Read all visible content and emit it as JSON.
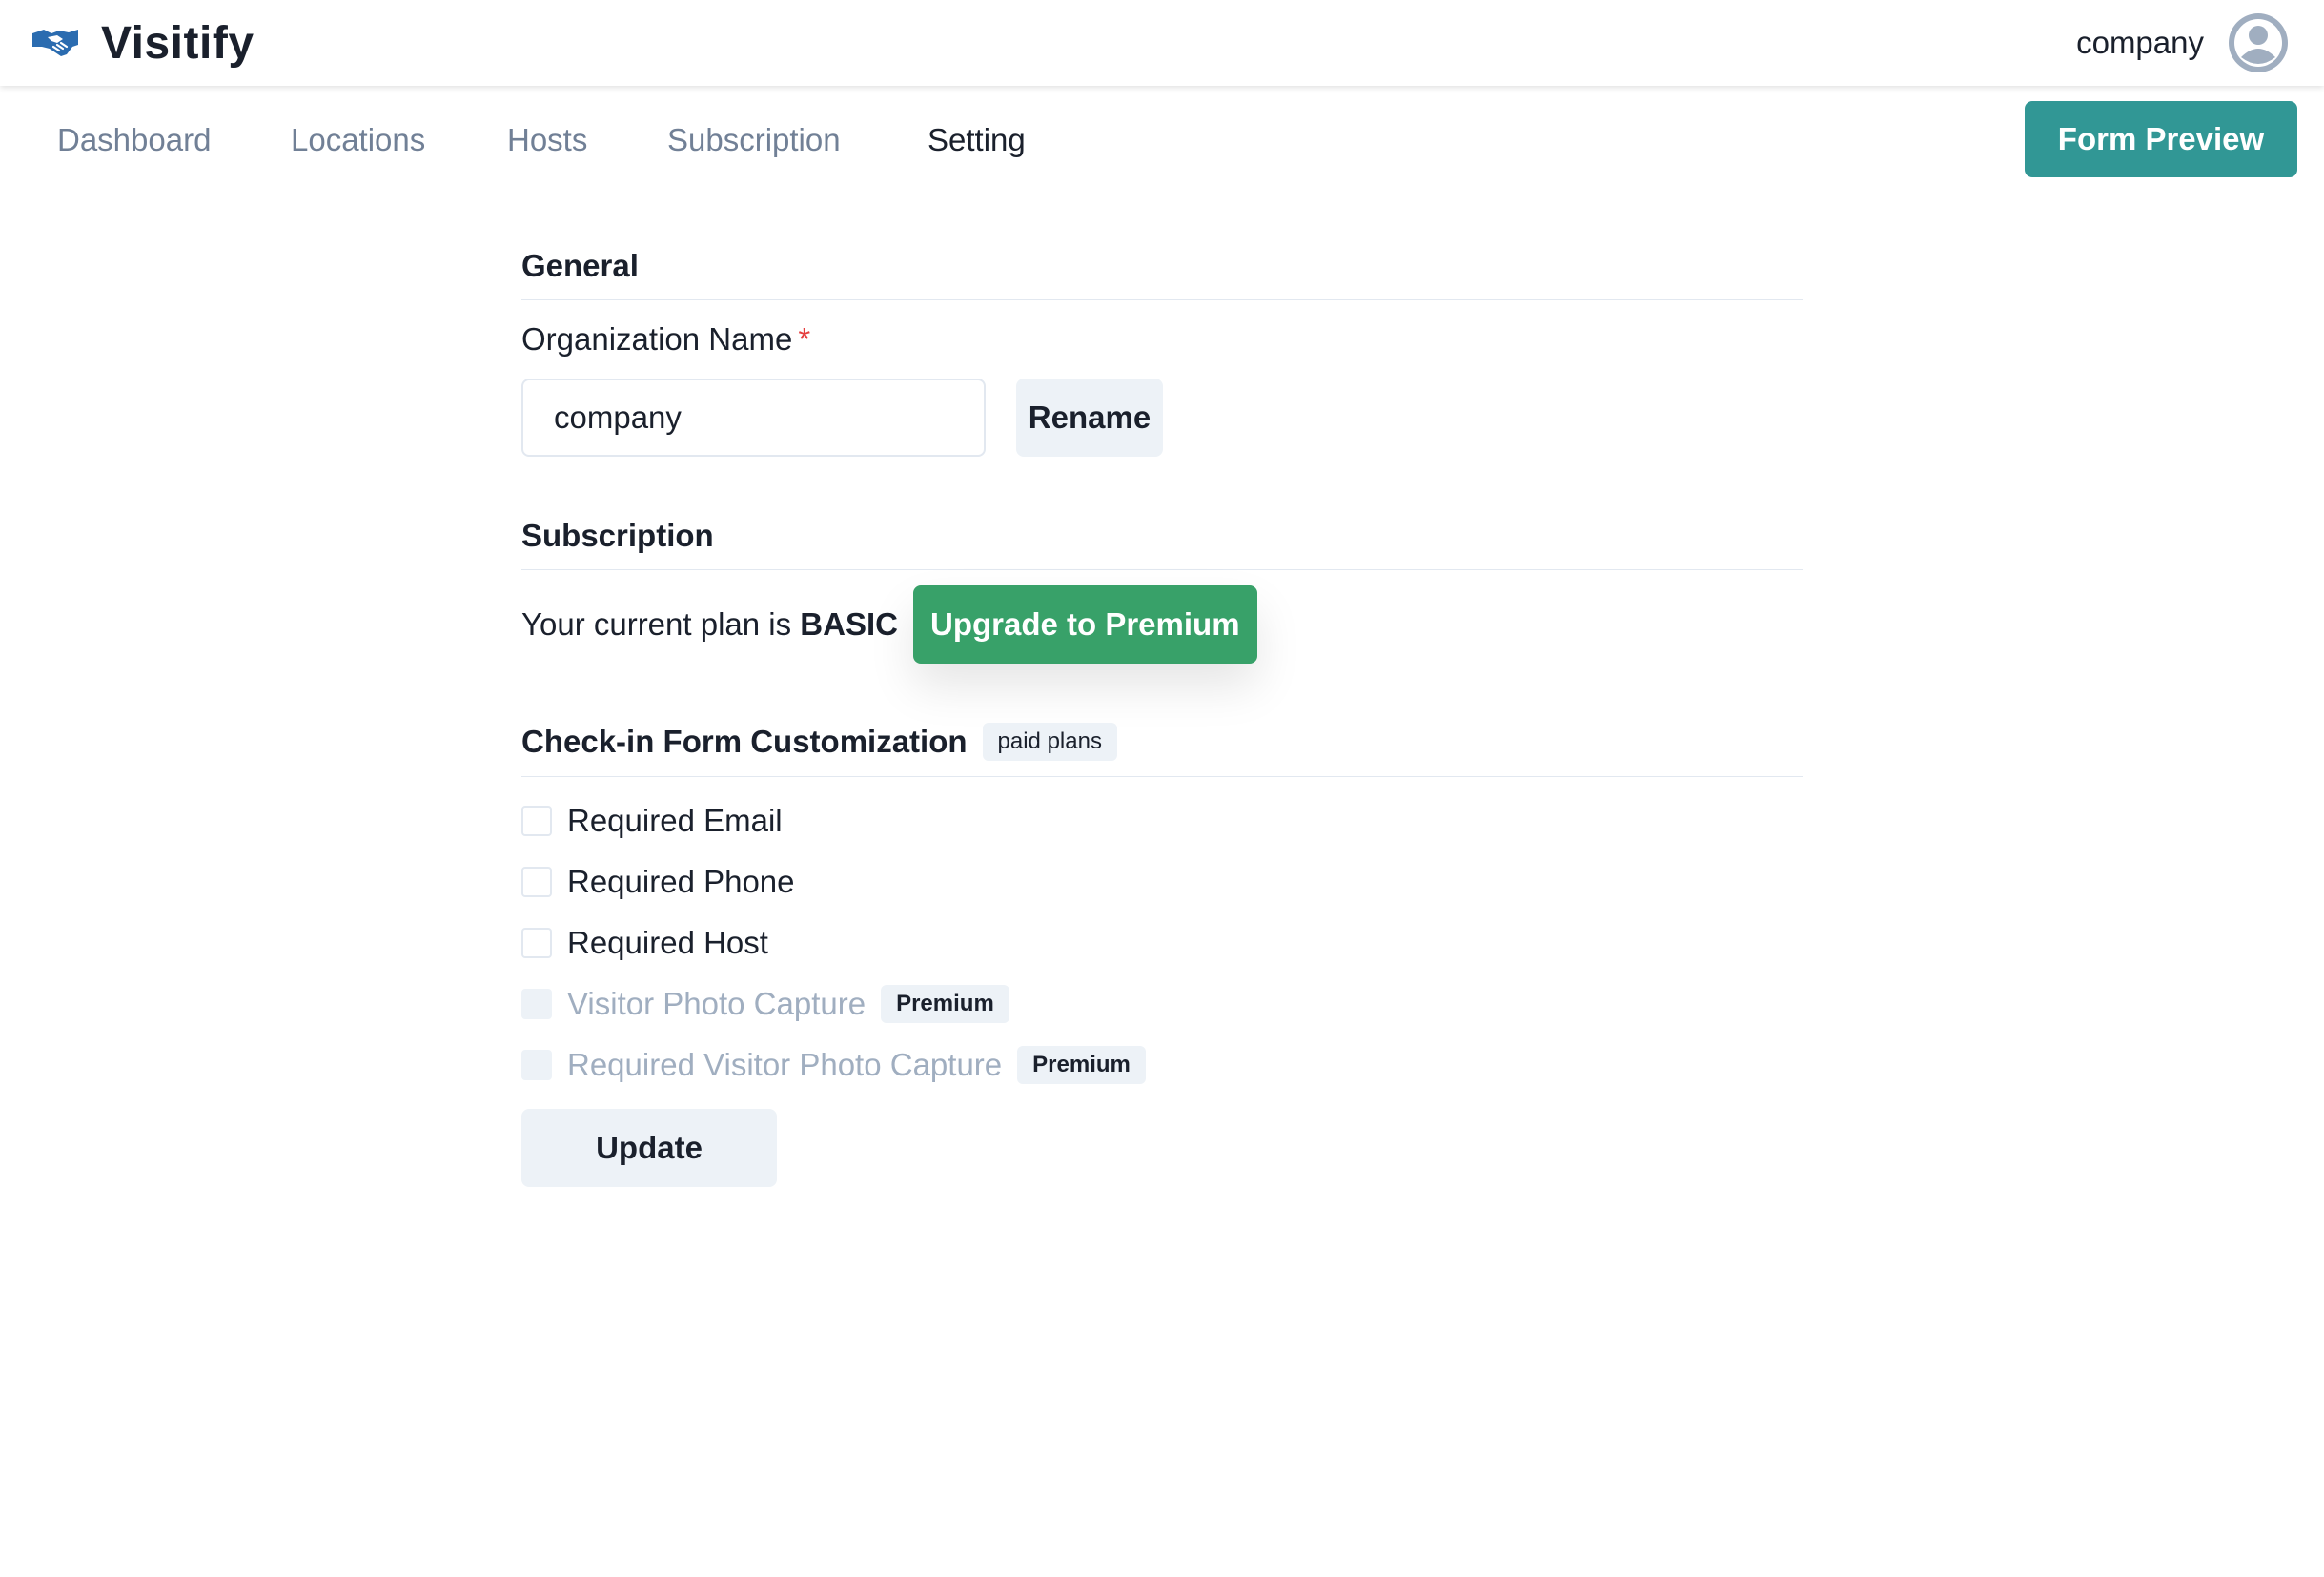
{
  "app": {
    "name": "Visitify"
  },
  "user": {
    "name": "company"
  },
  "nav": {
    "tabs": [
      {
        "label": "Dashboard"
      },
      {
        "label": "Locations"
      },
      {
        "label": "Hosts"
      },
      {
        "label": "Subscription"
      },
      {
        "label": "Setting"
      }
    ],
    "active_tab": "Setting",
    "form_preview_label": "Form Preview"
  },
  "general": {
    "title": "General",
    "org_label": "Organization Name",
    "required_mark": "*",
    "org_value": "company",
    "rename_label": "Rename"
  },
  "subscription": {
    "title": "Subscription",
    "plan_prefix": "Your current plan is",
    "plan_name": "BASIC",
    "upgrade_label": "Upgrade to Premium"
  },
  "checkin": {
    "title": "Check-in Form Customization",
    "badge": "paid plans",
    "options": [
      {
        "label": "Required Email",
        "checked": false,
        "disabled": false,
        "badge": ""
      },
      {
        "label": "Required Phone",
        "checked": false,
        "disabled": false,
        "badge": ""
      },
      {
        "label": "Required Host",
        "checked": false,
        "disabled": false,
        "badge": ""
      },
      {
        "label": "Visitor Photo Capture",
        "checked": false,
        "disabled": true,
        "badge": "Premium"
      },
      {
        "label": "Required Visitor Photo Capture",
        "checked": false,
        "disabled": true,
        "badge": "Premium"
      }
    ],
    "update_label": "Update"
  },
  "colors": {
    "primary_teal": "#319795",
    "upgrade_green": "#38a169",
    "logo_blue": "#2b6cb0",
    "required_red": "#e53e3e",
    "muted_text": "#718096"
  },
  "icons": {
    "logo": "handshake-icon",
    "avatar": "user-circle-icon"
  }
}
